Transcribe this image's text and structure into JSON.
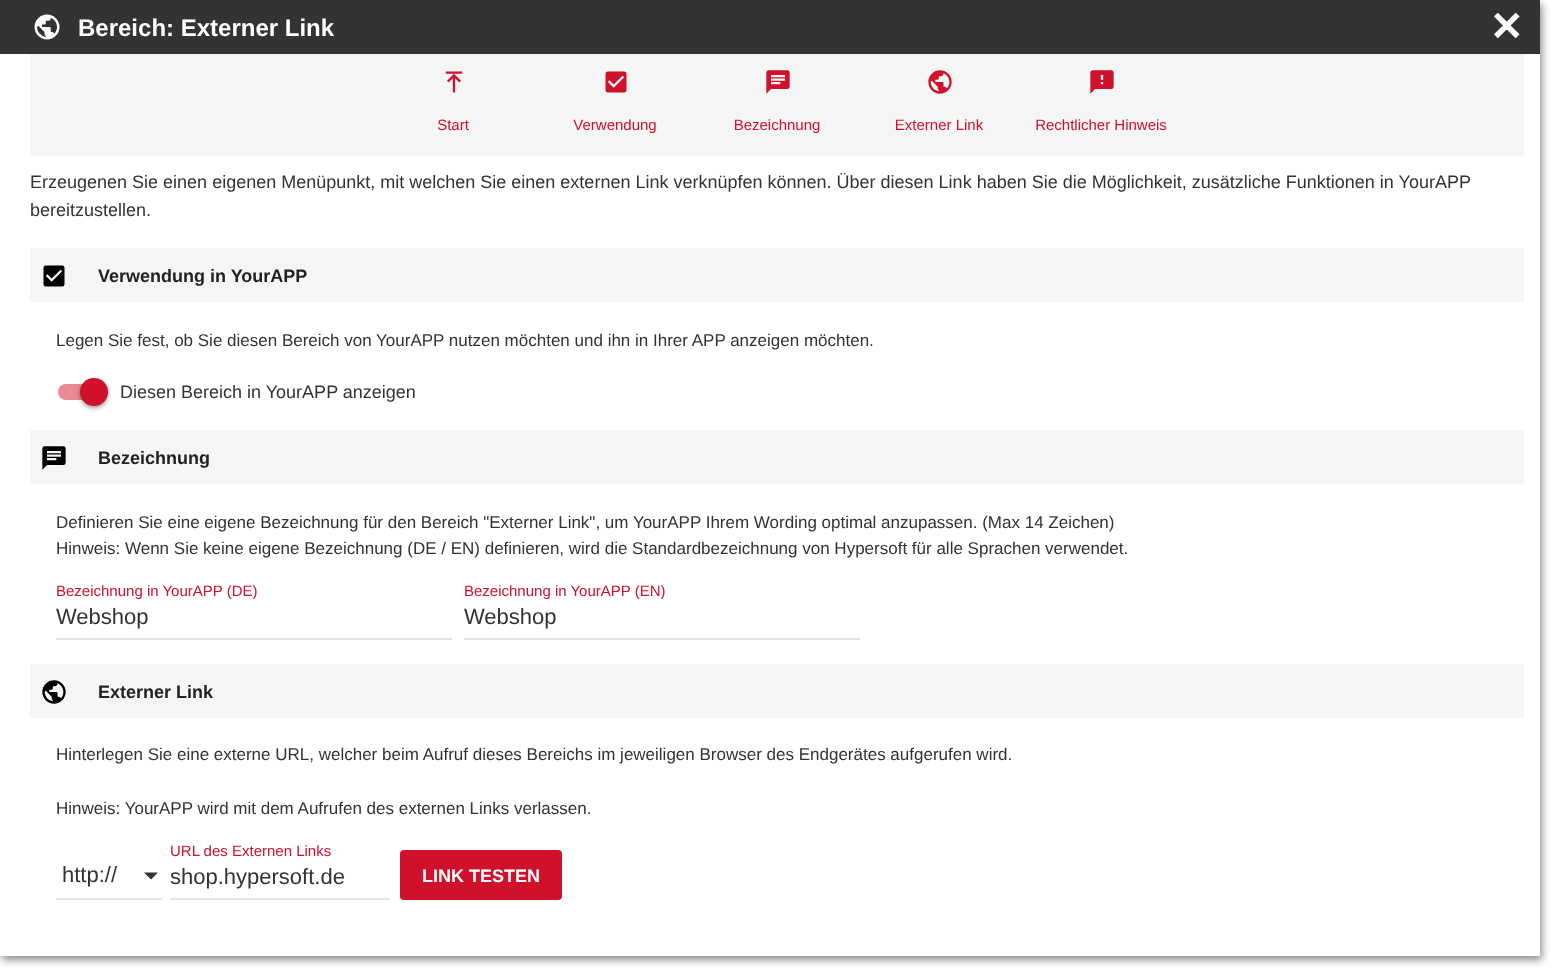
{
  "window": {
    "title": "Bereich: Externer Link",
    "close": "✕"
  },
  "nav": [
    {
      "label": "Start"
    },
    {
      "label": "Verwendung"
    },
    {
      "label": "Bezeichnung"
    },
    {
      "label": "Externer Link"
    },
    {
      "label": "Rechtlicher Hinweis"
    }
  ],
  "intro": "Erzeugenen Sie einen eigenen Menüpunkt, mit welchen Sie einen externen Link verknüpfen können. Über diesen Link haben Sie die Möglichkeit, zusätzliche Funktionen in YourAPP bereitzustellen.",
  "sections": [
    {
      "kind": "usage",
      "title": "Verwendung in YourAPP",
      "texts": [
        "Legen Sie fest, ob Sie diesen Bereich von YourAPP nutzen möchten und ihn in Ihrer APP anzeigen möchten."
      ],
      "toggle": {
        "label": "Diesen Bereich in YourAPP anzeigen",
        "on": true
      }
    },
    {
      "kind": "naming",
      "title": "Bezeichnung",
      "texts": [
        "Definieren Sie eine eigene Bezeichnung für den Bereich \"Externer Link\", um YourAPP Ihrem Wording optimal anzupassen. (Max 14 Zeichen)",
        "Hinweis: Wenn Sie keine eigene Bezeichnung (DE / EN) definieren, wird die Standardbezeichnung von Hypersoft für alle Sprachen verwendet."
      ],
      "fields": [
        {
          "label": "Bezeichnung in YourAPP (DE)",
          "value": "Webshop"
        },
        {
          "label": "Bezeichnung in YourAPP (EN)",
          "value": "Webshop"
        }
      ]
    },
    {
      "kind": "link",
      "title": "Externer Link",
      "texts": [
        "Hinterlegen Sie eine externe URL, welcher beim Aufruf dieses Bereichs im jeweiligen Browser des Endgerätes aufgerufen wird.",
        "Hinweis: YourAPP wird mit dem Aufrufen des externen Links verlassen."
      ],
      "protocol": "http://",
      "url": {
        "label": "URL des Externen Links",
        "value": "shop.hypersoft.de"
      },
      "button": "LINK TESTEN"
    }
  ]
}
